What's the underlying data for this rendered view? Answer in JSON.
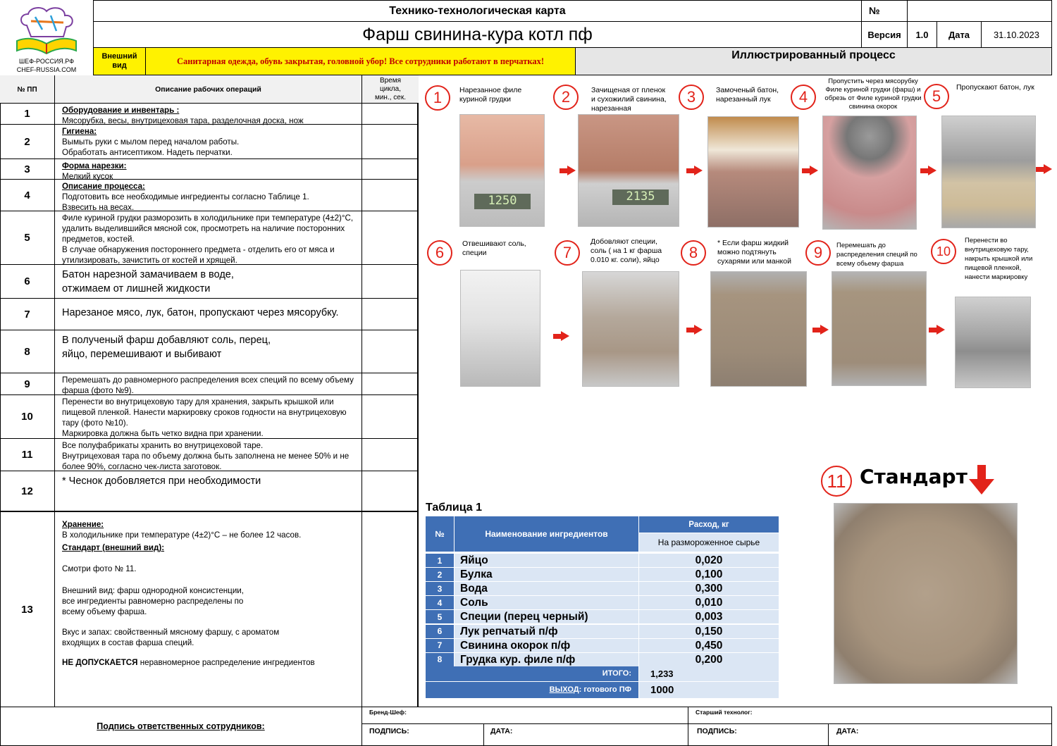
{
  "logo": {
    "line1": "ШЕФ-РОССИЯ.РФ",
    "line2": "CHEF-RUSSIA.COM"
  },
  "header": {
    "doc_type": "Технико-технологическая карта",
    "title": "Фарш свинина-кура котл пф",
    "number_label": "№",
    "number_value": "",
    "version_label": "Версия",
    "version_value": "1.0",
    "date_label": "Дата",
    "date_value": "31.10.2023",
    "appearance_label": "Внешний вид",
    "sanitary_note": "Санитарная одежда, обувь закрытая, головной убор! Все сотрудники работают в перчатках!",
    "process_title": "Иллюстрированный процесс"
  },
  "table": {
    "col_num": "№ ПП",
    "col_desc": "Описание рабочих операций",
    "col_time": "Время цикла, мин., сек.",
    "rows": [
      {
        "num": "1",
        "title": "Оборудование и инвентарь :",
        "text": "Мясорубка, весы, внутрицеховая тара, разделочная доска, нож"
      },
      {
        "num": "2",
        "title": "Гигиена:",
        "text": "Вымыть руки с мылом перед началом работы.\nОбработать антисептиком. Надеть перчатки."
      },
      {
        "num": "3",
        "title": "Форма нарезки:",
        "text": "Мелкий кусок"
      },
      {
        "num": "4",
        "title": "Описание процесса:",
        "text": "Подготовить все необходимые ингредиенты согласно Таблице 1.\nВзвесить на весах."
      },
      {
        "num": "5",
        "title": "",
        "text": "Филе куриной грудки разморозить в холодильнике при температуре (4±2)°С, удалить выделившийся мясной сок, просмотреть на наличие посторонних предметов, костей.\nВ случае обнаружения постороннего предмета - отделить его от мяса и утилизировать, зачистить от костей и хрящей."
      },
      {
        "num": "6",
        "title": "",
        "text": "Батон нарезной  замачиваем в воде,\nотжимаем от лишней жидкости"
      },
      {
        "num": "7",
        "title": "",
        "text": "Нарезаное мясо, лук, батон, пропускают через мясорубку."
      },
      {
        "num": "8",
        "title": "",
        "text": "В полученый фарш добавляют соль, перец,\nяйцо, перемешивают и выбивают"
      },
      {
        "num": "9",
        "title": "",
        "text": "Перемешать до равномерного распределения всех специй по всему объему фарша (фото №9)."
      },
      {
        "num": "10",
        "title": "",
        "text": "Перенести во внутрицеховую тару для хранения, закрыть крышкой или пищевой пленкой. Нанести маркировку сроков годности на внутрицеховую тару (фото №10).\nМаркировка должна быть четко видна при хранении."
      },
      {
        "num": "11",
        "title": "",
        "text": "Все полуфабрикаты хранить во внутрицеховой таре.\nВнутрицеховая тара по объему должна быть заполнена не менее 50% и не более 90%, согласно чек-листа заготовок."
      },
      {
        "num": "12",
        "title": "",
        "text": "* Чеснок добовляется при необходимости"
      },
      {
        "num": "13",
        "storage_title": "Хранение:",
        "storage_text": "В холодильнике при температуре (4±2)°С – не более 12 часов.",
        "standard_title": "Стандарт (внешний вид):",
        "see_photo": "Смотри фото № 11.",
        "appearance": "Внешний вид: фарш однородной консистенции,\nвсе ингредиенты равномерно распределены по\nвсему объему фарша.",
        "taste": "Вкус и запах: свойственный мясному фаршу, с ароматом\nвходящих в состав фарша специй.",
        "not_allowed_bold": "НЕ ДОПУСКАЕТСЯ",
        "not_allowed_text": " неравномерное распределение ингредиентов"
      }
    ]
  },
  "steps": [
    {
      "n": "1",
      "caption": "Нарезанное филе\nкуриной грудки"
    },
    {
      "n": "2",
      "caption": "Зачищеная от пленок\nи сухожилий свинина,\nнарезанная"
    },
    {
      "n": "3",
      "caption": "Замоченый батон,\nнарезанный лук"
    },
    {
      "n": "4",
      "caption": "Пропустить через мясорубку\nФиле куриной грудки (фарш) и\nобрезь от Филе куриной грудки\nсвинина окорок"
    },
    {
      "n": "5",
      "caption": "Пропускают батон, лук"
    },
    {
      "n": "6",
      "caption": "Отвешивают соль,\nспеции"
    },
    {
      "n": "7",
      "caption": "Добовляют специи,\nсоль ( на 1 кг фарша\n 0.010 кг. соли), яйцо"
    },
    {
      "n": "8",
      "caption": "* Если фарш жидкий\nможно подтянуть\n сухарями или манкой"
    },
    {
      "n": "9",
      "caption": "Перемешать до\nраспределения специй по\nвсему обьему фарша"
    },
    {
      "n": "10",
      "caption": "Перенести во\nвнутрицеховую тару,\nнакрыть крышкой или\nпищевой пленкой,\nнанести маркировку"
    }
  ],
  "scale_readings": {
    "s1": "1250",
    "s2": "2135"
  },
  "standard": {
    "n": "11",
    "label": "Стандарт"
  },
  "ingredients": {
    "title": "Таблица 1",
    "col_num": "№",
    "col_name": "Наименование ингредиентов",
    "col_consumption": "Расход, кг",
    "col_sub": "На размороженное сырье",
    "rows": [
      {
        "num": "1",
        "name": "Яйцо",
        "value": "0,020"
      },
      {
        "num": "2",
        "name": "Булка",
        "value": "0,100"
      },
      {
        "num": "3",
        "name": "Вода",
        "value": "0,300"
      },
      {
        "num": "4",
        "name": "Соль",
        "value": "0,010"
      },
      {
        "num": "5",
        "name": "Специи (перец черный)",
        "value": "0,003"
      },
      {
        "num": "6",
        "name": "Лук репчатый п/ф",
        "value": "0,150"
      },
      {
        "num": "7",
        "name": "Свинина окорок п/ф",
        "value": "0,450"
      },
      {
        "num": "8",
        "name": "Грудка кур. филе п/ф",
        "value": "0,200"
      }
    ],
    "total_label": "ИТОГО:",
    "total_value": "1,233",
    "yield_label_link": "ВЫХОД",
    "yield_label_rest": ": готового ПФ",
    "yield_value": "1000"
  },
  "footer": {
    "signature_label": "Подпись ответственных сотрудников:",
    "brand_chef": "Бренд-Шеф:",
    "senior_tech": "Старший технолог:",
    "sign": "ПОДПИСЬ:",
    "date": "ДАТА:"
  }
}
